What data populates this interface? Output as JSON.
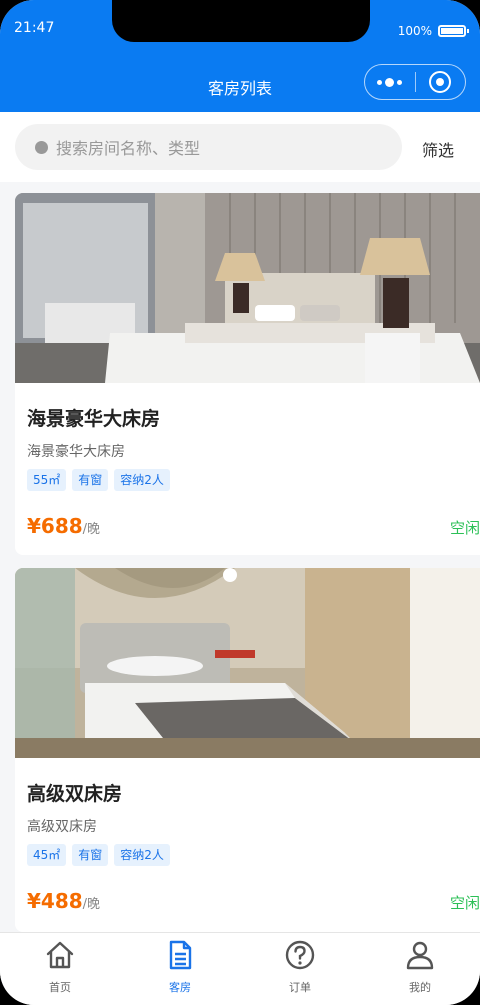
{
  "status_bar": {
    "time": "21:47",
    "battery": "100%"
  },
  "nav": {
    "title": "客房列表"
  },
  "search": {
    "placeholder": "搜索房间名称、类型",
    "filter_label": "筛选"
  },
  "rooms": [
    {
      "name": "海景豪华大床房",
      "subtitle": "海景豪华大床房",
      "tags": [
        "55㎡",
        "有窗",
        "容纳2人"
      ],
      "price": "¥688",
      "unit": "/晚",
      "status": "空闲"
    },
    {
      "name": "高级双床房",
      "subtitle": "高级双床房",
      "tags": [
        "45㎡",
        "有窗",
        "容纳2人"
      ],
      "price": "¥488",
      "unit": "/晚",
      "status": "空闲"
    }
  ],
  "tabbar": {
    "items": [
      {
        "label": "首页",
        "icon": "home-icon"
      },
      {
        "label": "客房",
        "icon": "document-icon"
      },
      {
        "label": "订单",
        "icon": "question-icon"
      },
      {
        "label": "我的",
        "icon": "user-icon"
      }
    ],
    "active_index": 1
  },
  "colors": {
    "primary": "#0a7bf2",
    "price": "#f56c00",
    "available": "#2cc057",
    "tag_bg": "#e6f1fd"
  }
}
